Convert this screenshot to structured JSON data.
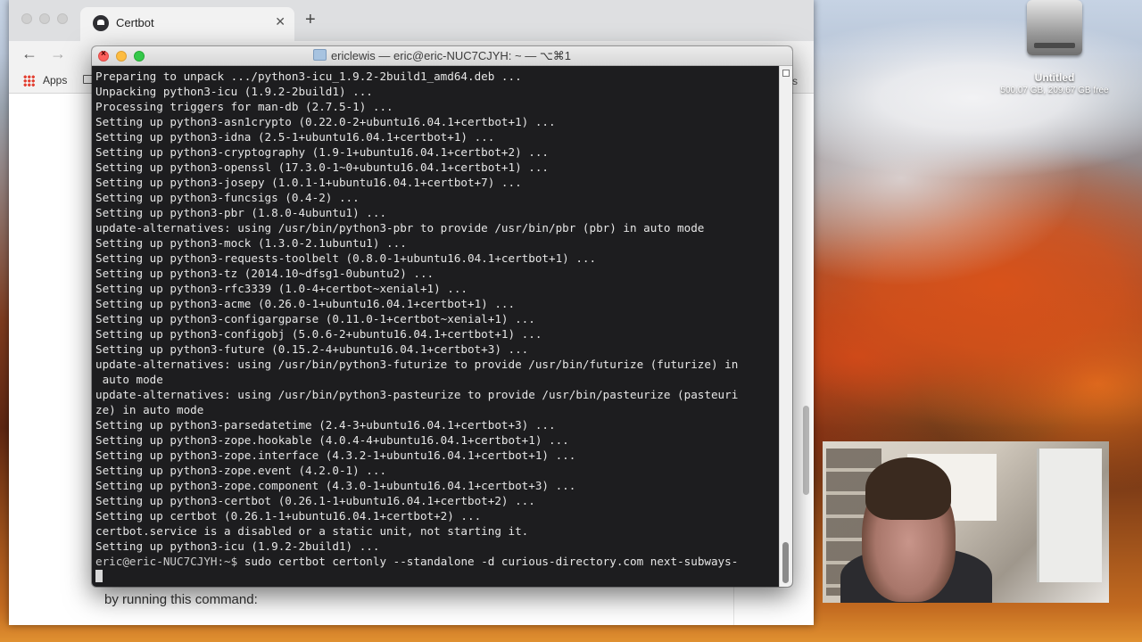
{
  "desktop": {
    "disk_name": "Untitled",
    "disk_info": "500.07 GB, 209.67 GB free"
  },
  "browser": {
    "tab_title": "Certbot",
    "close_glyph": "✕",
    "new_tab_glyph": "+",
    "back_glyph": "←",
    "forward_glyph": "→",
    "bookmarks": {
      "apps_label": "Apps",
      "right_label": "ks"
    },
    "page_text": "by running this command:"
  },
  "terminal": {
    "title": "ericlewis — eric@eric-NUC7CJYH: ~ — ⌥⌘1",
    "lines": [
      "Preparing to unpack .../python3-icu_1.9.2-2build1_amd64.deb ...",
      "Unpacking python3-icu (1.9.2-2build1) ...",
      "Processing triggers for man-db (2.7.5-1) ...",
      "Setting up python3-asn1crypto (0.22.0-2+ubuntu16.04.1+certbot+1) ...",
      "Setting up python3-idna (2.5-1+ubuntu16.04.1+certbot+1) ...",
      "Setting up python3-cryptography (1.9-1+ubuntu16.04.1+certbot+2) ...",
      "Setting up python3-openssl (17.3.0-1~0+ubuntu16.04.1+certbot+1) ...",
      "Setting up python3-josepy (1.0.1-1+ubuntu16.04.1+certbot+7) ...",
      "Setting up python3-funcsigs (0.4-2) ...",
      "Setting up python3-pbr (1.8.0-4ubuntu1) ...",
      "update-alternatives: using /usr/bin/python3-pbr to provide /usr/bin/pbr (pbr) in auto mode",
      "Setting up python3-mock (1.3.0-2.1ubuntu1) ...",
      "Setting up python3-requests-toolbelt (0.8.0-1+ubuntu16.04.1+certbot+1) ...",
      "Setting up python3-tz (2014.10~dfsg1-0ubuntu2) ...",
      "Setting up python3-rfc3339 (1.0-4+certbot~xenial+1) ...",
      "Setting up python3-acme (0.26.0-1+ubuntu16.04.1+certbot+1) ...",
      "Setting up python3-configargparse (0.11.0-1+certbot~xenial+1) ...",
      "Setting up python3-configobj (5.0.6-2+ubuntu16.04.1+certbot+1) ...",
      "Setting up python3-future (0.15.2-4+ubuntu16.04.1+certbot+3) ...",
      "update-alternatives: using /usr/bin/python3-futurize to provide /usr/bin/futurize (futurize) in",
      " auto mode",
      "update-alternatives: using /usr/bin/python3-pasteurize to provide /usr/bin/pasteurize (pasteuri",
      "ze) in auto mode",
      "Setting up python3-parsedatetime (2.4-3+ubuntu16.04.1+certbot+3) ...",
      "Setting up python3-zope.hookable (4.0.4-4+ubuntu16.04.1+certbot+1) ...",
      "Setting up python3-zope.interface (4.3.2-1+ubuntu16.04.1+certbot+1) ...",
      "Setting up python3-zope.event (4.2.0-1) ...",
      "Setting up python3-zope.component (4.3.0-1+ubuntu16.04.1+certbot+3) ...",
      "Setting up python3-certbot (0.26.1-1+ubuntu16.04.1+certbot+2) ...",
      "Setting up certbot (0.26.1-1+ubuntu16.04.1+certbot+2) ...",
      "certbot.service is a disabled or a static unit, not starting it.",
      "Setting up python3-icu (1.9.2-2build1) ..."
    ],
    "prompt": "eric@eric-NUC7CJYH:~$",
    "command": " sudo certbot certonly --standalone -d curious-directory.com next-subways-"
  },
  "colors": {
    "terminal_bg": "#1d1d1f",
    "terminal_text": "#e6e6e6",
    "close": "#fc605c",
    "minimize": "#fdbc40",
    "maximize": "#34c84a"
  }
}
